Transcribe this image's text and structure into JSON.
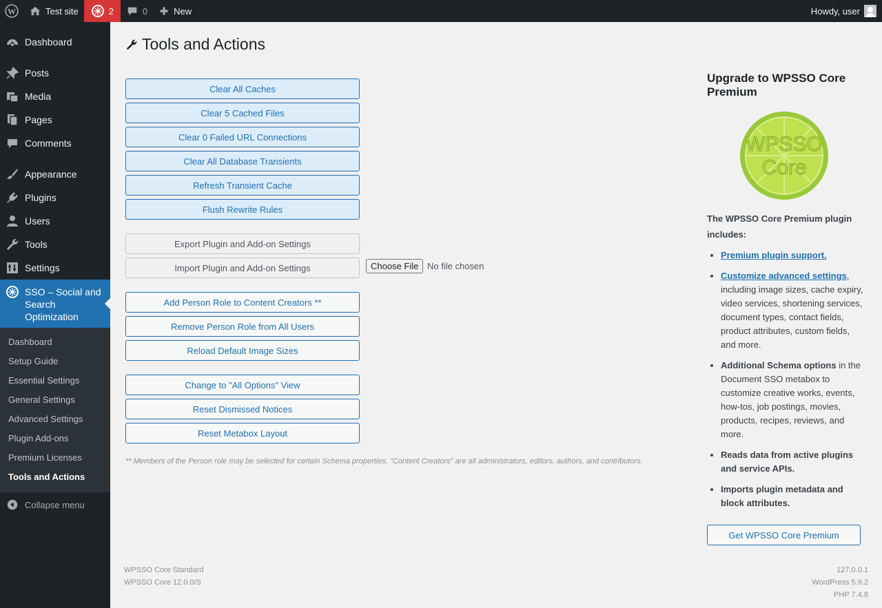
{
  "admin_bar": {
    "site_name": "Test site",
    "updates_count": "2",
    "comments_count": "0",
    "new_label": "New",
    "greeting": "Howdy, user"
  },
  "sidebar": {
    "items": [
      {
        "label": "Dashboard",
        "icon": "dashboard-icon"
      },
      {
        "label": "Posts",
        "icon": "pin-icon"
      },
      {
        "label": "Media",
        "icon": "media-icon"
      },
      {
        "label": "Pages",
        "icon": "pages-icon"
      },
      {
        "label": "Comments",
        "icon": "comment-icon"
      },
      {
        "label": "Appearance",
        "icon": "brush-icon"
      },
      {
        "label": "Plugins",
        "icon": "plugin-icon"
      },
      {
        "label": "Users",
        "icon": "user-icon"
      },
      {
        "label": "Tools",
        "icon": "wrench-icon"
      },
      {
        "label": "Settings",
        "icon": "settings-icon"
      }
    ],
    "active": {
      "label": "SSO – Social and Search Optimization",
      "icon": "wpsso-icon"
    },
    "submenu": [
      "Dashboard",
      "Setup Guide",
      "Essential Settings",
      "General Settings",
      "Advanced Settings",
      "Plugin Add-ons",
      "Premium Licenses",
      "Tools and Actions"
    ],
    "collapse_label": "Collapse menu"
  },
  "page": {
    "title": "Tools and Actions"
  },
  "buttons": {
    "group1": [
      "Clear All Caches",
      "Clear 5 Cached Files",
      "Clear 0 Failed URL Connections",
      "Clear All Database Transients",
      "Refresh Transient Cache",
      "Flush Rewrite Rules"
    ],
    "export": "Export Plugin and Add-on Settings",
    "import": "Import Plugin and Add-on Settings",
    "choose_file": "Choose File",
    "file_status": "No file chosen",
    "group3": [
      "Add Person Role to Content Creators **",
      "Remove Person Role from All Users",
      "Reload Default Image Sizes"
    ],
    "group4": [
      "Change to \"All Options\" View",
      "Reset Dismissed Notices",
      "Reset Metabox Layout"
    ]
  },
  "footnote": "** Members of the Person role may be selected for certain Schema properties. \"Content Creators\" are all administrators, editors, authors, and contributors.",
  "upgrade": {
    "title": "Upgrade to WPSSO Core Premium",
    "logo_text_1": "WPSSO",
    "logo_text_2": "Core",
    "intro": "The WPSSO Core Premium plugin includes:",
    "f1_link": "Premium plugin support.",
    "f2_link": "Customize advanced settings",
    "f2_rest": ", including image sizes, cache expiry, video services, shortening services, document types, contact fields, product attributes, custom fields, and more.",
    "f3_bold": "Additional Schema options",
    "f3_rest": " in the Document SSO metabox to customize creative works, events, how-tos, job postings, movies, products, recipes, reviews, and more.",
    "f4": "Reads data from active plugins and service APIs.",
    "f5": "Imports plugin metadata and block attributes.",
    "button": "Get WPSSO Core Premium"
  },
  "footer": {
    "left1": "WPSSO Core Standard",
    "left2": "WPSSO Core 12.0.0/S",
    "right1": "127.0.0.1",
    "right2": "WordPress 5.9.2",
    "right3": "PHP 7.4.8"
  },
  "colors": {
    "admin_bg": "#1d2327",
    "accent": "#2271b1",
    "updates_bg": "#d63638",
    "lemon": "#9bc83a"
  }
}
